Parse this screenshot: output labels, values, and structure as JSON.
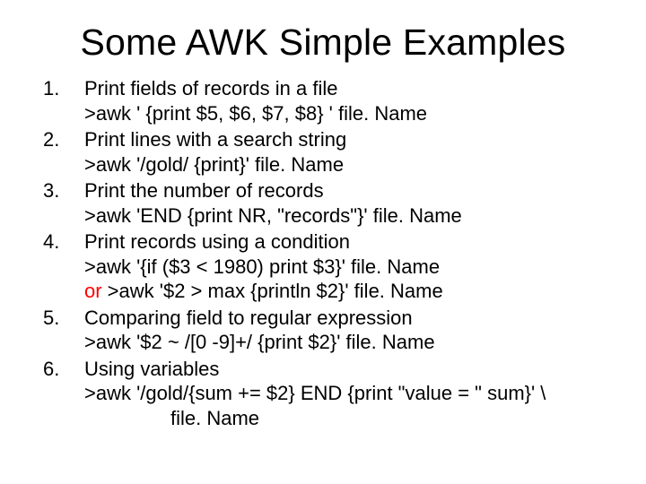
{
  "title": "Some AWK Simple Examples",
  "items": [
    {
      "desc": "Print fields of records in a file",
      "code": ">awk ' {print $5, $6, $7, $8} ' file. Name"
    },
    {
      "desc": "Print lines with a search string",
      "code": ">awk '/gold/ {print}' file. Name"
    },
    {
      "desc": "Print the number of records",
      "code": ">awk 'END {print NR, \"records\"}' file. Name"
    },
    {
      "desc": "Print records using a condition",
      "code": ">awk '{if ($3 < 1980) print $3}' file. Name",
      "or": "or",
      "alt": " >awk '$2 > max {println $2}' file. Name"
    },
    {
      "desc": "Comparing field to regular expression",
      "code": ">awk '$2 ~ /[0 -9]+/ {print $2}' file. Name"
    },
    {
      "desc": "Using variables",
      "code": ">awk '/gold/{sum += $2} END {print \"value = \" sum}' \\",
      "continuation": "file. Name"
    }
  ]
}
